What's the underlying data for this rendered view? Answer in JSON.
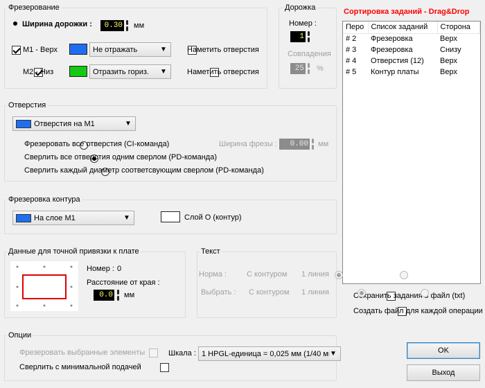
{
  "milling": {
    "title": "Фрезерование",
    "track_width_label": "Ширина дорожки :",
    "track_width_value": "0.30",
    "track_width_unit": "мм",
    "m1": {
      "label": "M1 - Верх",
      "checked": true,
      "color": "#1e6ff0",
      "mode": "Не отражать",
      "mark_holes": "Наметить отверстия",
      "mark_checked": false
    },
    "m2": {
      "label": "M2 - Низ",
      "checked": true,
      "color": "#14c814",
      "mode": "Отразить гориз.",
      "mark_holes": "Наметить отверстия",
      "mark_checked": false
    }
  },
  "track": {
    "title": "Дорожка",
    "number_label": "Номер :",
    "number_value": "1",
    "overlap_label": "Совпадения",
    "overlap_value": "25",
    "overlap_unit": "%"
  },
  "sort": {
    "title": "Сортировка заданий - Drag&Drop",
    "title_color": "#ff0000",
    "columns": [
      "Перо",
      "Список заданий",
      "Сторона"
    ],
    "rows": [
      [
        "# 2",
        "Фрезеровка",
        "Верх"
      ],
      [
        "# 3",
        "Фрезеровка",
        "Снизу"
      ],
      [
        "# 4",
        "Отверстия (12)",
        "Верх"
      ],
      [
        "# 5",
        "Контур платы",
        "Верх"
      ]
    ],
    "save_tasks": "Сохранить задания в файл (txt)",
    "file_per_op": "Создать файл для каждой операции"
  },
  "holes": {
    "title": "Отверстия",
    "layer_select": "Отверстия на M1",
    "layer_color": "#1e6ff0",
    "mill_width_label": "Ширина фрезы :",
    "mill_width_value": "0.00",
    "mill_width_unit": "мм",
    "options": [
      {
        "label": "Фрезеровать все отверстия (CI-команда)",
        "selected": false
      },
      {
        "label": "Сверлить все отверстия одним сверлом (PD-команда)",
        "selected": true
      },
      {
        "label": "Сверлить каждый диаметр соответсвующим сверлом (PD-команда)",
        "selected": false
      }
    ]
  },
  "contour": {
    "title": "Фрезеровка контура",
    "layer_select": "На слое  M1",
    "layer_color": "#1e6ff0",
    "layer_label": "Слой O (контур)"
  },
  "anchor": {
    "title": "Данные для точной привязки к плате",
    "number_label": "Номер :",
    "number_value": "0",
    "distance_label": "Расстояние от края :",
    "distance_value": "0.0",
    "distance_unit": "мм"
  },
  "text": {
    "title": "Текст",
    "norm_label": "Норма :",
    "select_label": "Выбрать :",
    "with_contour": "С контуром",
    "one_line": "1 линия"
  },
  "options": {
    "title": "Опции",
    "mill_selected": "Фрезеровать выбранные элементы",
    "drill_min_feed": "Сверлить с минимальной подачей",
    "scale_label": "Шкала :",
    "scale_value": "1 HPGL-единица = 0,025 мм (1/40 мм)"
  },
  "buttons": {
    "ok": "OK",
    "exit": "Выход"
  }
}
